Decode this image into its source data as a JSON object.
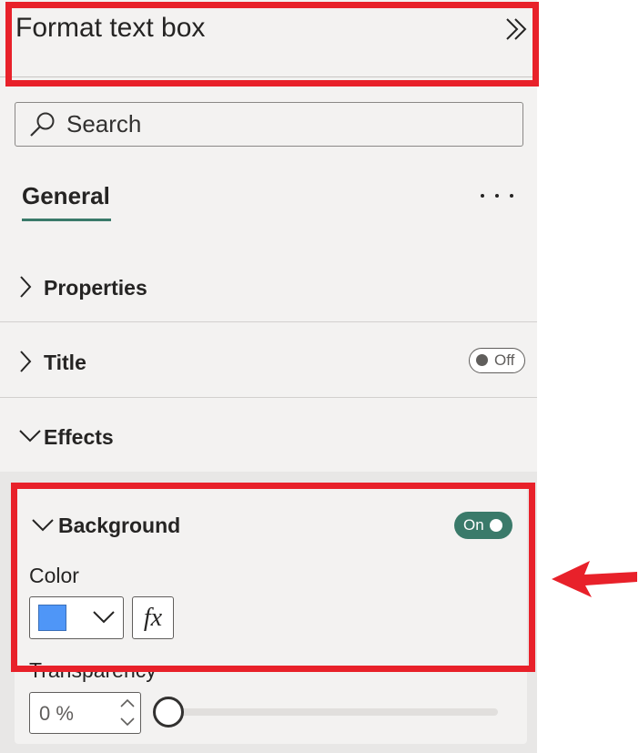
{
  "panel": {
    "title": "Format text box",
    "collapse_icon": "double-chevron-right-icon"
  },
  "search": {
    "placeholder": "Search",
    "icon": "search-icon"
  },
  "tabs": {
    "active_label": "General",
    "more_icon": "more-dots-icon"
  },
  "sections": {
    "properties": {
      "label": "Properties",
      "expanded": false
    },
    "title": {
      "label": "Title",
      "expanded": false,
      "toggle_label": "Off"
    },
    "effects": {
      "label": "Effects",
      "expanded": true
    }
  },
  "background": {
    "label": "Background",
    "expanded": true,
    "toggle_label": "On",
    "color_label": "Color",
    "color_value": "#4f96f7",
    "fx_label": "fx",
    "transparency_label": "Transparency",
    "transparency_value": "0 %",
    "transparency_fraction": 0
  },
  "colors": {
    "accent": "#3a7a6a",
    "highlight": "#e8212a",
    "panel_bg": "#f3f2f1"
  }
}
